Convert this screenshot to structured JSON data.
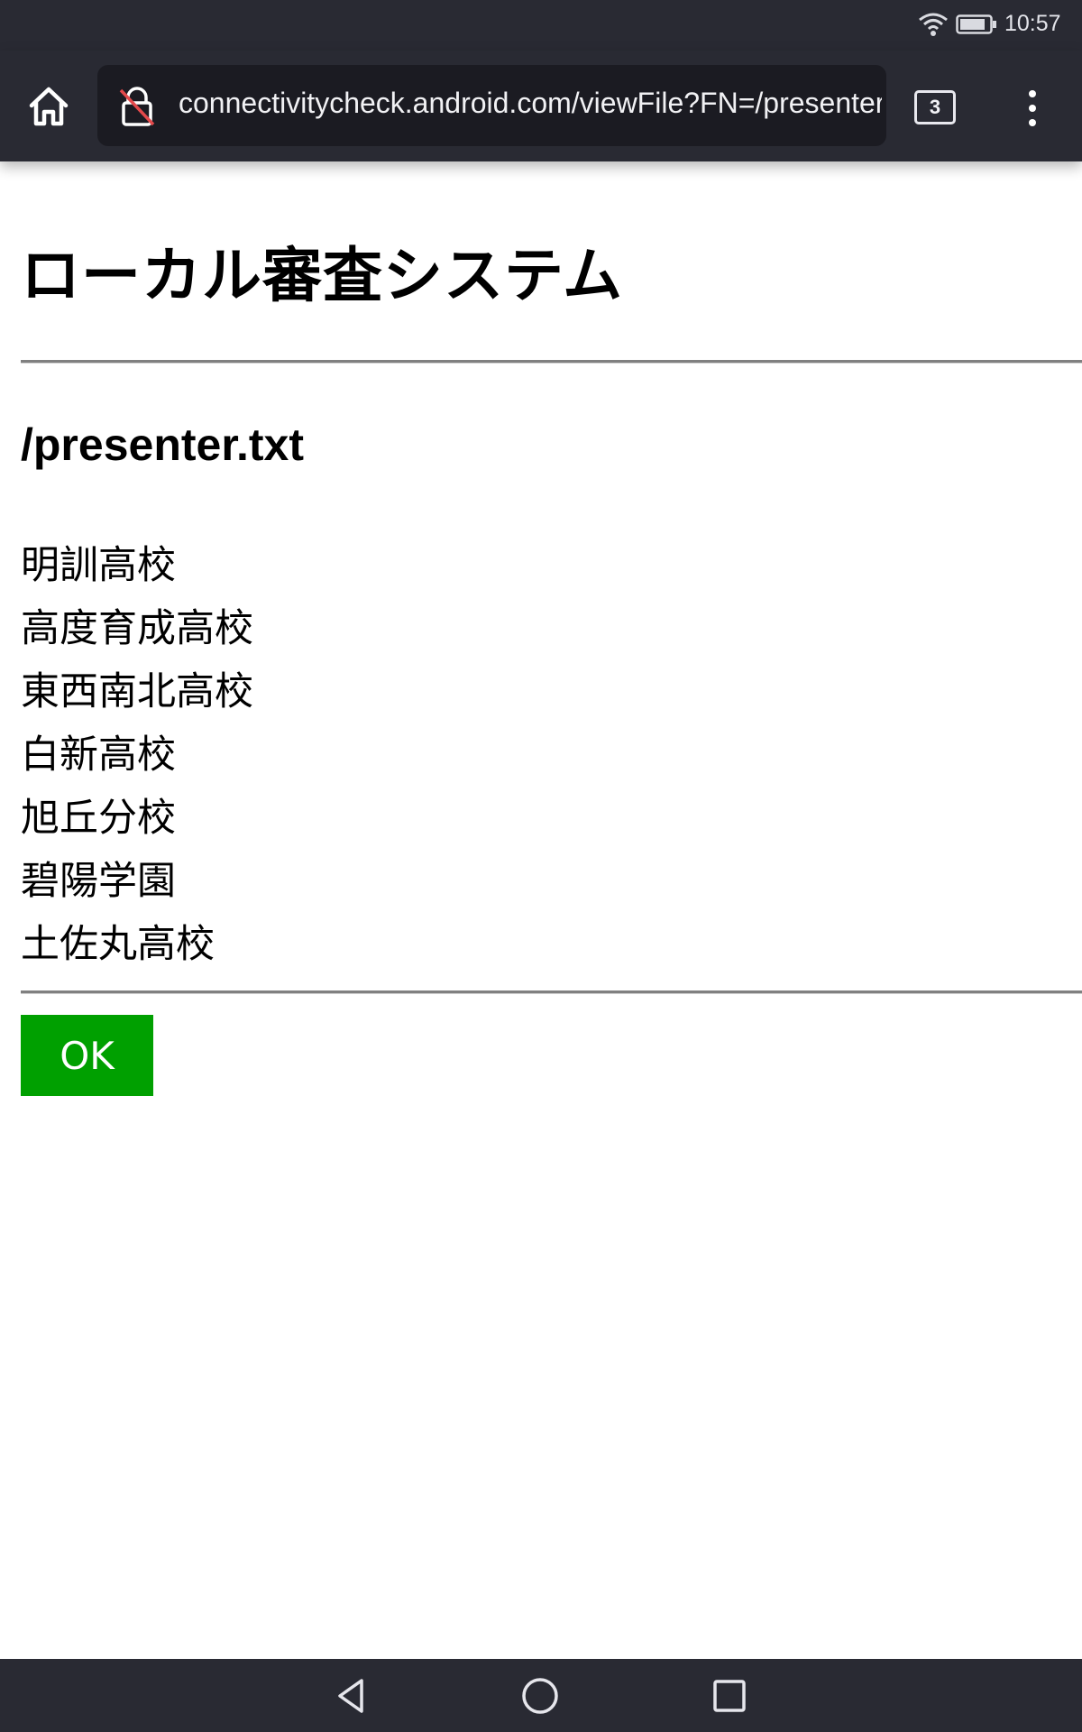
{
  "status_bar": {
    "time": "10:57"
  },
  "browser": {
    "url": "connectivitycheck.android.com/viewFile?FN=/presenter.txt",
    "tab_count": "3",
    "toolbar_color": "#292a33"
  },
  "page": {
    "title": "ローカル審査システム",
    "file_name": "/presenter.txt",
    "schools": [
      "明訓高校",
      "高度育成高校",
      "東西南北高校",
      "白新高校",
      "旭丘分校",
      "碧陽学園",
      "土佐丸高校"
    ],
    "ok_label": "OK",
    "ok_color": "#00a000"
  },
  "icons": {
    "status": [
      "wifi-icon",
      "battery-icon"
    ],
    "toolbar": [
      "home-icon",
      "not-secure-lock-icon",
      "tabs-counter",
      "more-vert-icon"
    ],
    "navigation": [
      "back-icon",
      "home-circle-icon",
      "recents-icon"
    ]
  }
}
